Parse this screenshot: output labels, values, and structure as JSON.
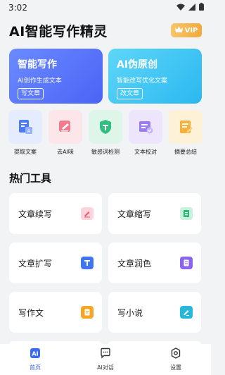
{
  "status_bar": {
    "time": "3:02"
  },
  "header": {
    "title": "AI智能写作精灵",
    "vip_label": "VIP"
  },
  "hero_cards": [
    {
      "title": "智能写作",
      "subtitle": "AI创作生成文本",
      "button": "写文章"
    },
    {
      "title": "AI伪原创",
      "subtitle": "智能改写优化文案",
      "button": "改文章"
    }
  ],
  "tools": [
    {
      "label": "提取文案"
    },
    {
      "label": "去AI味"
    },
    {
      "label": "敏感词检测"
    },
    {
      "label": "文本校对"
    },
    {
      "label": "摘要总结"
    }
  ],
  "section_title": "热门工具",
  "hot_tools": [
    {
      "label": "文章续写"
    },
    {
      "label": "文章缩写"
    },
    {
      "label": "文章扩写"
    },
    {
      "label": "文章润色"
    },
    {
      "label": "写作文"
    },
    {
      "label": "写小说"
    }
  ],
  "tabbar": [
    {
      "label": "首页"
    },
    {
      "label": "AI对话"
    },
    {
      "label": "设置"
    }
  ],
  "colors": {
    "primary": "#3b6cf6",
    "vip_gold": "#f3a93a",
    "hero_left": "#4c63f5",
    "hero_right": "#2bb8f0"
  }
}
